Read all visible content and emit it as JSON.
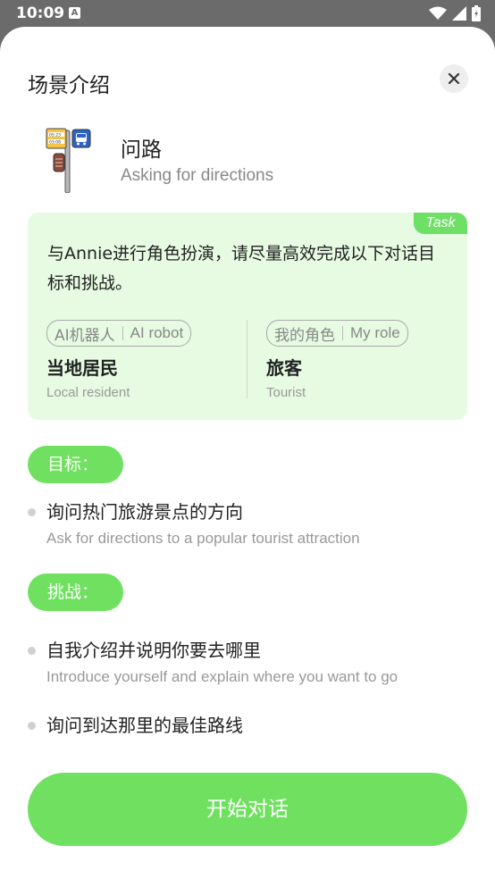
{
  "status_bar": {
    "time": "10:09",
    "notification_badge": "A"
  },
  "sheet": {
    "title": "场景介绍"
  },
  "scene": {
    "title_cn": "问路",
    "title_en": "Asking for directions",
    "sign_times": [
      "05:23",
      "03:08"
    ]
  },
  "task": {
    "badge": "Task",
    "description": "与Annie进行角色扮演，请尽量高效完成以下对话目标和挑战。",
    "ai_role": {
      "pill_cn": "AI机器人",
      "pill_en": "AI robot",
      "name_cn": "当地居民",
      "name_en": "Local resident"
    },
    "my_role": {
      "pill_cn": "我的角色",
      "pill_en": "My role",
      "name_cn": "旅客",
      "name_en": "Tourist"
    }
  },
  "goal": {
    "label": "目标：",
    "items": [
      {
        "cn": "询问热门旅游景点的方向",
        "en": "Ask for directions to a popular tourist attraction"
      }
    ]
  },
  "challenge": {
    "label": "挑战：",
    "items": [
      {
        "cn": "自我介绍并说明你要去哪里",
        "en": "Introduce yourself and explain where you want to go"
      },
      {
        "cn": "询问到达那里的最佳路线",
        "en": ""
      }
    ]
  },
  "start_button": {
    "label": "开始对话"
  },
  "colors": {
    "accent": "#70e060",
    "card_bg": "#e6fbe2",
    "overlay": "#6b6b6b"
  }
}
